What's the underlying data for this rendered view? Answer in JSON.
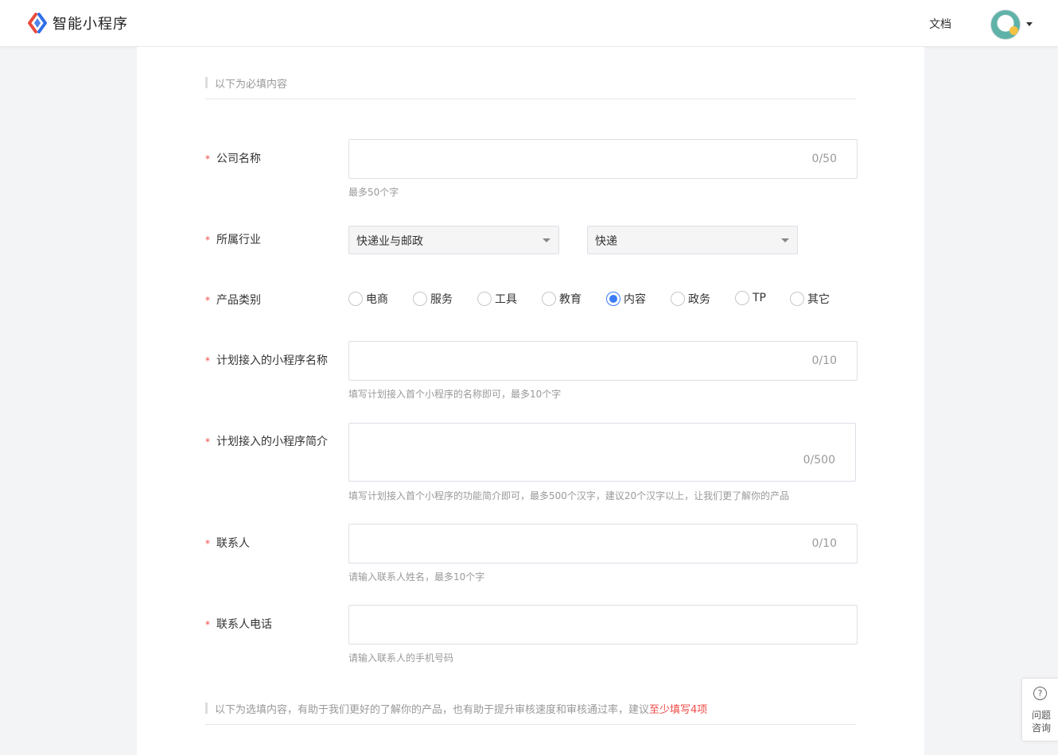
{
  "header": {
    "brand": "智能小程序",
    "doc_link": "文档"
  },
  "sections": {
    "required_heading": "以下为必填内容",
    "optional_heading": "以下为选填内容，有助于我们更好的了解你的产品，也有助于提升审核速度和审核通过率，建议",
    "optional_highlight": "至少填写4项"
  },
  "form": {
    "required_mark": "*",
    "company": {
      "label": "公司名称",
      "value": "",
      "counter": "0/50",
      "hint": "最多50个字"
    },
    "industry": {
      "label": "所属行业",
      "primary": "快递业与邮政",
      "secondary": "快递"
    },
    "category": {
      "label": "产品类别",
      "options": [
        "电商",
        "服务",
        "工具",
        "教育",
        "内容",
        "政务",
        "TP",
        "其它"
      ],
      "selected": "内容"
    },
    "app_name": {
      "label": "计划接入的小程序名称",
      "value": "",
      "counter": "0/10",
      "hint": "填写计划接入首个小程序的名称即可，最多10个字"
    },
    "app_intro": {
      "label": "计划接入的小程序简介",
      "value": "",
      "counter": "0/500",
      "hint": "填写计划接入首个小程序的功能简介即可，最多500个汉字，建议20个汉字以上，让我们更了解你的产品"
    },
    "contact": {
      "label": "联系人",
      "value": "",
      "counter": "0/10",
      "hint": "请输入联系人姓名，最多10个字"
    },
    "phone": {
      "label": "联系人电话",
      "value": "",
      "hint": "请输入联系人的手机号码"
    }
  },
  "help": {
    "line1": "问题",
    "line2": "咨询"
  },
  "colors": {
    "accent": "#3b7cf6",
    "required": "#f04a45",
    "brand_red": "#e94b3c",
    "brand_blue": "#2f6ee8"
  }
}
